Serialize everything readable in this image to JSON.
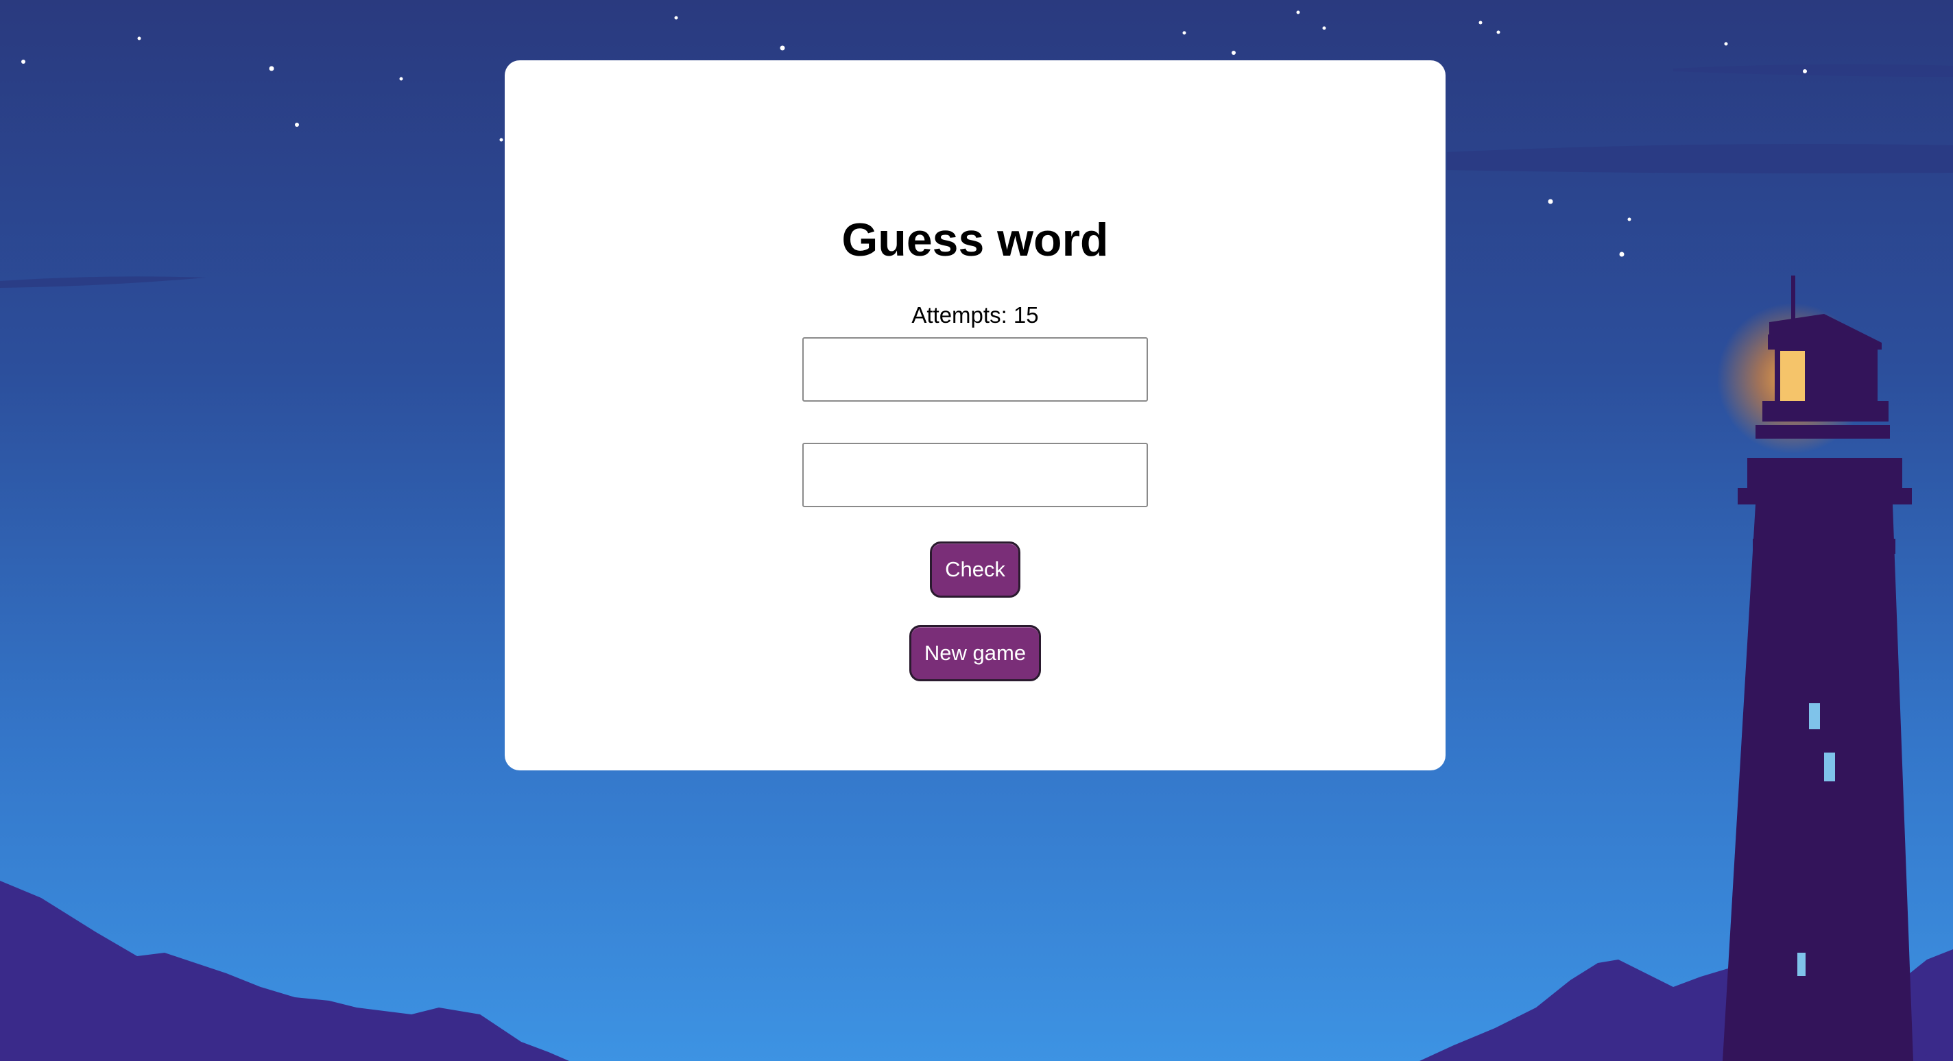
{
  "game": {
    "title": "Guess word",
    "attempts_label": "Attempts: 15",
    "input_1_value": "",
    "input_2_value": "",
    "check_label": "Check",
    "new_game_label": "New game"
  },
  "colors": {
    "button_bg": "#7a2e78",
    "card_bg": "#ffffff",
    "sky_top": "#2a3a7f",
    "sky_bottom": "#3d93e3",
    "lighthouse": "#33145a",
    "lamp": "#f5a63a",
    "mountains": "#3a2a8a"
  }
}
